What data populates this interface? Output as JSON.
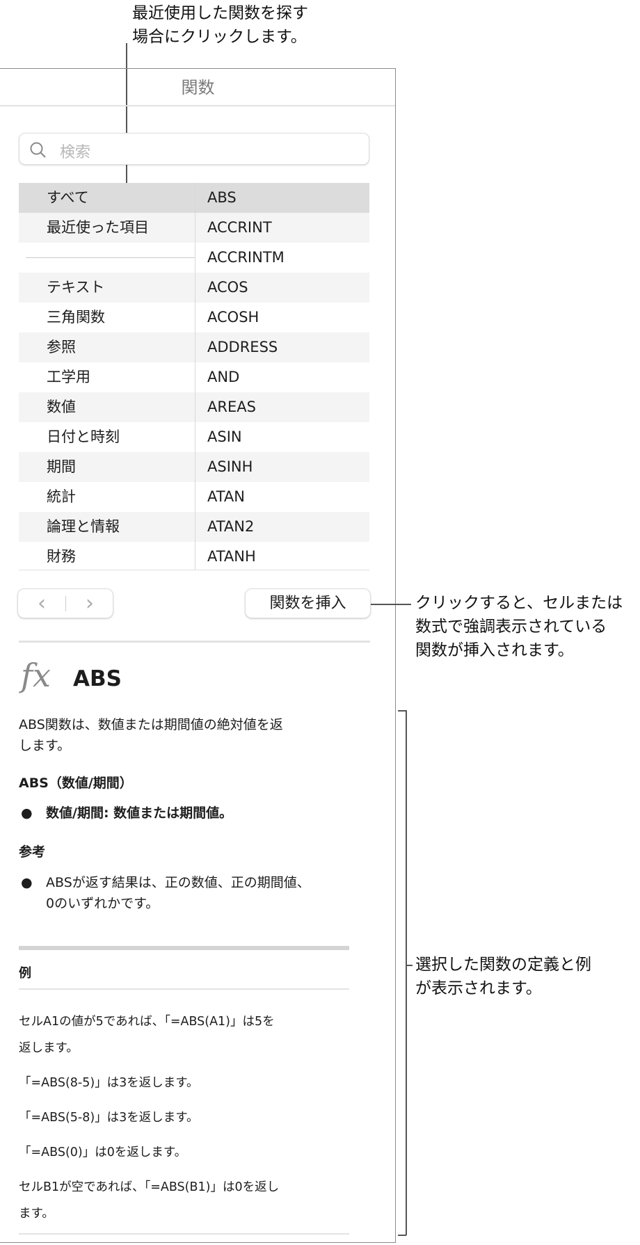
{
  "callouts": {
    "recent": [
      "最近使用した関数を探す",
      "場合にクリックします。"
    ],
    "insert": [
      "クリックすると、セルまたは",
      "数式で強調表示されている",
      "関数が挿入されます。"
    ],
    "definition": [
      "選択した関数の定義と例",
      "が表示されます。"
    ]
  },
  "panel": {
    "title": "関数"
  },
  "search": {
    "placeholder": "検索"
  },
  "categories": [
    "すべて",
    "最近使った項目",
    "",
    "テキスト",
    "三角関数",
    "参照",
    "工学用",
    "数値",
    "日付と時刻",
    "期間",
    "統計",
    "論理と情報",
    "財務"
  ],
  "functions": [
    "ABS",
    "ACCRINT",
    "ACCRINTM",
    "ACOS",
    "ACOSH",
    "ADDRESS",
    "AND",
    "AREAS",
    "ASIN",
    "ASINH",
    "ATAN",
    "ATAN2",
    "ATANH"
  ],
  "nav": {
    "back": "‹",
    "forward": "›"
  },
  "insert_button": "関数を挿入",
  "detail": {
    "fx": "fx",
    "name": "ABS",
    "description": [
      "ABS関数は、数値または期間値の絶対値を返",
      "します。"
    ],
    "syntax": "ABS（数値/期間）",
    "arg": "数値/期間: 数値または期間値。",
    "notes_heading": "参考",
    "note": [
      "ABSが返す結果は、正の数値、正の期間値、",
      "0のいずれかです。"
    ],
    "examples_heading": "例",
    "examples": [
      [
        "セルA1の値が5であれば、「=ABS(A1)」は5を",
        "返します。"
      ],
      [
        "「=ABS(8-5)」は3を返します。"
      ],
      [
        "「=ABS(5-8)」は3を返します。"
      ],
      [
        "「=ABS(0)」は0を返します。"
      ],
      [
        "セルB1が空であれば、「=ABS(B1)」は0を返し",
        "ます。"
      ]
    ]
  }
}
